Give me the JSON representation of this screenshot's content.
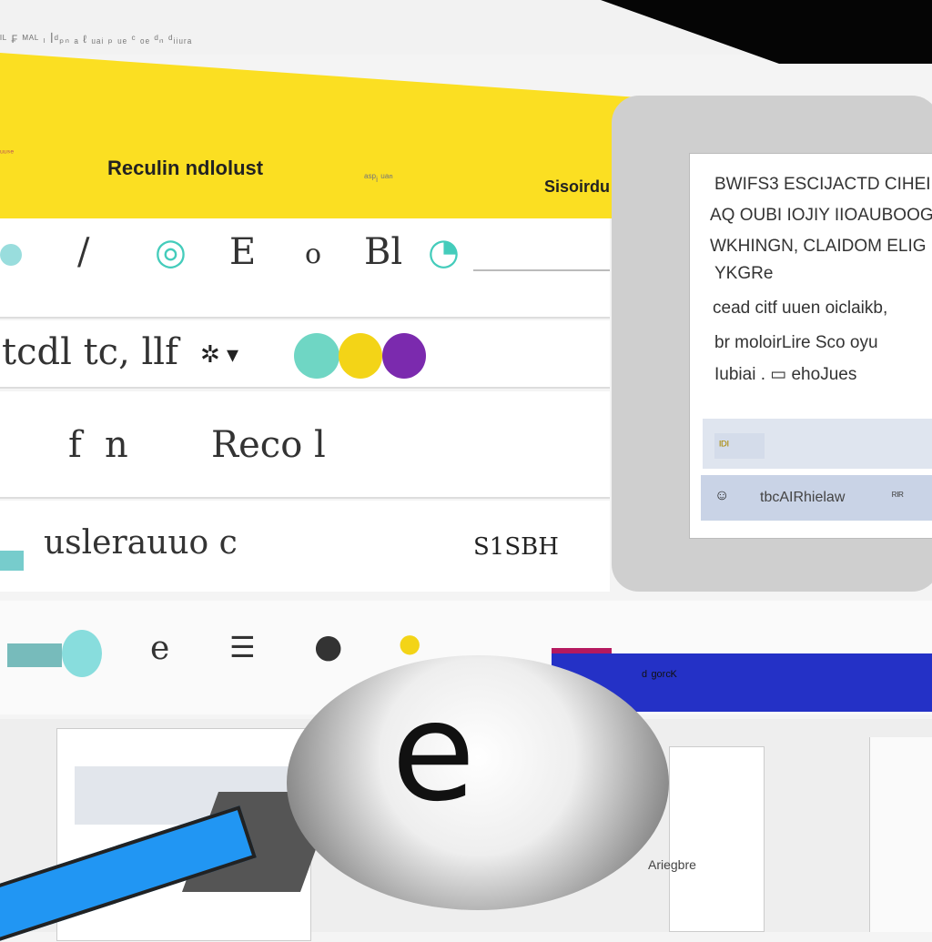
{
  "browser": {
    "url_text": "ᴵᴸ ₣ ᴹᴬᴸ ₗ ꟾᵈₚₙ ₐ ℓ ᵤₐᵢ ₚ ᵤₑ ᶜ ₒₑ ᵈₙ ᵈᵢᵢᵤᵣₐ"
  },
  "header": {
    "title": "Reculin ndlolust",
    "left_note": "ᵤᵤₛₑ",
    "middle_note": "ᵃˢᵖᵢ ᵘᵃⁿ",
    "right_label": "Sisoirdu",
    "color": "#fbdf22"
  },
  "rows": [
    {
      "glyphs": [
        "/",
        "◎",
        "E",
        "o",
        "Bl",
        "◔"
      ]
    },
    {
      "label": "tcdl tc, llf",
      "symbol": "✲ ▾",
      "colors": [
        "#6fd6c4",
        "#f3d417",
        "#7b2aae"
      ]
    },
    {
      "left": "f",
      "mid": "n",
      "word": "Reco l"
    },
    {
      "word": "uslerauuo c",
      "value": "S1SBH"
    },
    {
      "glyphs": [
        "e",
        "☰",
        "●",
        "●"
      ]
    }
  ],
  "panel": {
    "lines": [
      "BWIFS3 ESCIJACTD CIHEII",
      "AQ OUBI IOJIY IIOAUBOOG",
      "WKHINGN, CLAIDOM ELIG",
      "YKGRe",
      "cead citf uuen oiclaikb,",
      "br moloirLire Sco oyu",
      "Iubiai . ▭ ehoJues"
    ],
    "button_label": "ᴵᴰᴵ",
    "footer_label": "tbcAIRhielaw",
    "footer_right": "ᴿᴵᴿ"
  },
  "bluebar": {
    "label": "ᵈ ᵍᵒʳᶜᴷ",
    "color": "#2431c6"
  },
  "knob": {
    "glyph": "e"
  },
  "bottom": {
    "label": "Ariegbre"
  }
}
